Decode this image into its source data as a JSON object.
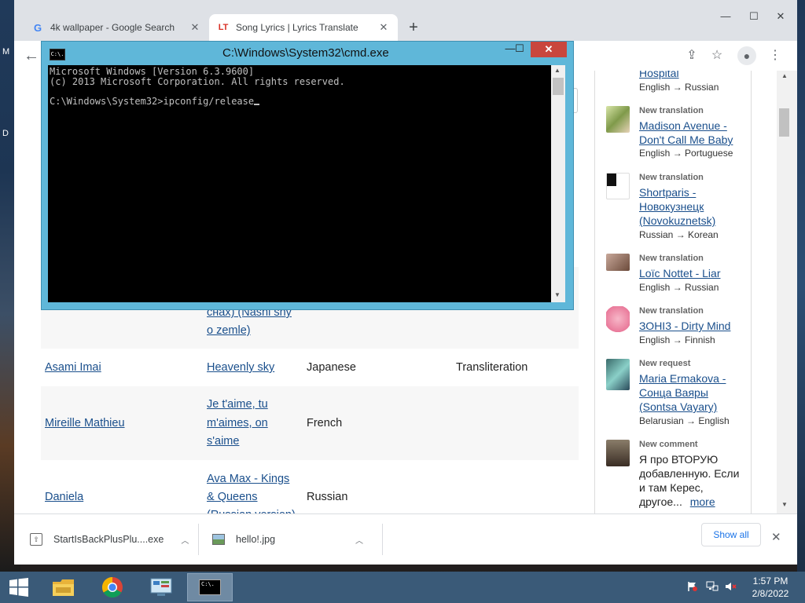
{
  "desktop": {
    "left_chars": [
      "M",
      "D"
    ]
  },
  "browser": {
    "tabs": [
      {
        "title": "4k wallpaper - Google Search",
        "favicon": "G",
        "active": false
      },
      {
        "title": "Song Lyrics | Lyrics Translate",
        "favicon": "LT",
        "active": true
      }
    ],
    "new_tab": "+",
    "controls": {
      "minimize": "—",
      "maximize": "☐",
      "close": "✕"
    },
    "toolbar": {
      "back": "←",
      "share": "⇪",
      "star": "☆",
      "profile": "●",
      "menu": "⋮"
    }
  },
  "table": {
    "partial_row": {
      "song_line1": "сна́х) (Nashi sny",
      "song_line2": "o zemle)"
    },
    "rows": [
      {
        "artist": "Asami Imai",
        "song": [
          "Heavenly sky"
        ],
        "language": "Japanese",
        "type": "Transliteration"
      },
      {
        "artist": "Mireille Mathieu",
        "song": [
          "Je t'aime, tu",
          "m'aimes, on",
          "s'aime"
        ],
        "language": "French",
        "type": ""
      },
      {
        "artist": "Daniela",
        "song": [
          "Ava Max - Kings",
          "& Queens",
          "(Russian version)"
        ],
        "language": "Russian",
        "type": ""
      }
    ]
  },
  "sidebar": {
    "top_partial": {
      "title": "Hospital",
      "lang": "English → Russian"
    },
    "items": [
      {
        "kind": "New translation",
        "title": [
          "Madison Avenue -",
          "Don't Call Me Baby"
        ],
        "lang": "English → Portuguese"
      },
      {
        "kind": "New translation",
        "title": [
          "Shortparis -",
          "Новокузнецк",
          "(Novokuznetsk)"
        ],
        "lang": "Russian → Korean"
      },
      {
        "kind": "New translation",
        "title": [
          "Loïc Nottet - Liar"
        ],
        "lang": "English → Russian"
      },
      {
        "kind": "New translation",
        "title": [
          "ЗОНІ3 - Dirty Mind"
        ],
        "lang": "English → Finnish"
      },
      {
        "kind": "New request",
        "title": [
          "Maria Ermakova -",
          "Сонца Ваяры",
          "(Sontsa Vayary)"
        ],
        "lang": "Belarusian → English"
      },
      {
        "kind": "New comment",
        "body": [
          "Я про ВТОРУЮ",
          "добавленную. Если",
          "и там Керес,",
          "другое..."
        ],
        "more": "more"
      }
    ]
  },
  "downloads": {
    "items": [
      {
        "name": "StartIsBackPlusPlu....exe",
        "icon": "installer-icon"
      },
      {
        "name": "hello!.jpg",
        "icon": "image-file-icon"
      }
    ],
    "show_all": "Show all",
    "close": "✕"
  },
  "cmd": {
    "title": "C:\\Windows\\System32\\cmd.exe",
    "icon_text": "C:\\.",
    "lines": [
      "Microsoft Windows [Version 6.3.9600]",
      "(c) 2013 Microsoft Corporation. All rights reserved.",
      "",
      "C:\\Windows\\System32>ipconfig/release"
    ],
    "controls": {
      "minimize": "—",
      "maximize": "☐",
      "close": "✕"
    }
  },
  "taskbar": {
    "time": "1:57 PM",
    "date": "2/8/2022"
  },
  "colors": {
    "link": "#1a4f8c",
    "cmd_frame": "#5fb7d9",
    "taskbar": "#3a5a78",
    "close_red": "#c9463d"
  }
}
